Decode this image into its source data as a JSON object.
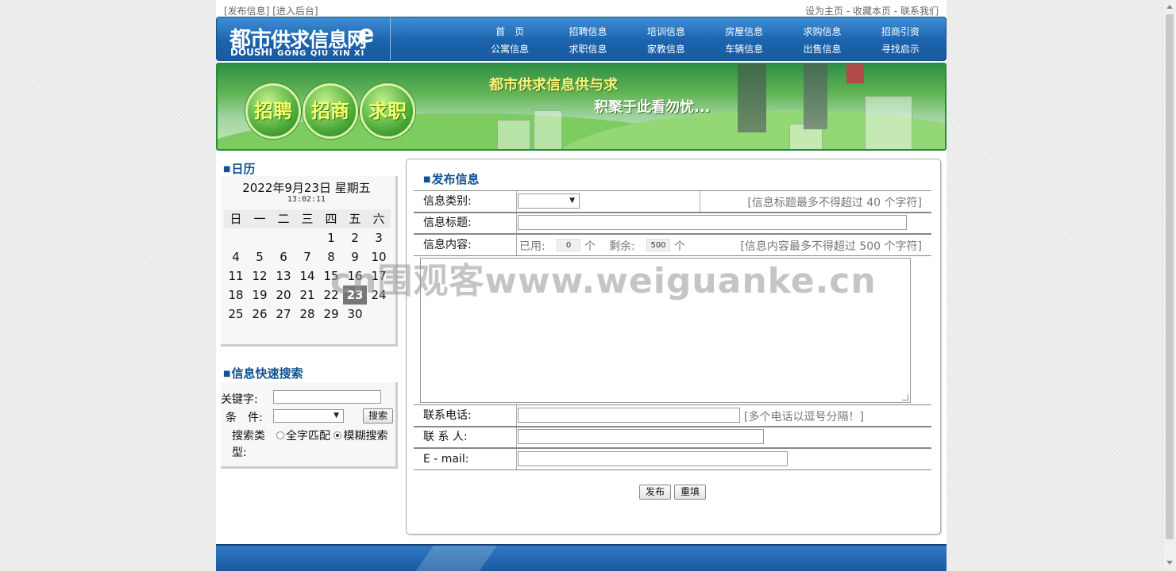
{
  "top_links": {
    "publish": "[发布信息]",
    "admin": "[进入后台]",
    "set_home": "设为主页",
    "sep1": " - ",
    "bookmark": "收藏本页",
    "sep2": " - ",
    "contact": "联系我们"
  },
  "logo": {
    "main_big": "都市",
    "main_rest": "供求信息网",
    "letter": "e",
    "sub_w1": "DOUSHI",
    "sub_w2": "GONG QIU XIN XI"
  },
  "nav": {
    "items": [
      "首　页",
      "招聘信息",
      "培训信息",
      "房屋信息",
      "求购信息",
      "招商引资",
      "公寓信息",
      "求职信息",
      "家教信息",
      "车辆信息",
      "出售信息",
      "寻找启示"
    ]
  },
  "banner": {
    "bubbles": [
      "招聘",
      "招商",
      "求职"
    ],
    "slogan1": "都市供求信息供与求",
    "slogan2": "积聚于此看勿忧..."
  },
  "calendar": {
    "title": "日历",
    "date": "2022年9月23日 星期五",
    "time": "13:02:11",
    "weekdays": [
      "日",
      "一",
      "二",
      "三",
      "四",
      "五",
      "六"
    ],
    "days": [
      "",
      "",
      "",
      "",
      "1",
      "2",
      "3",
      "4",
      "5",
      "6",
      "7",
      "8",
      "9",
      "10",
      "11",
      "12",
      "13",
      "14",
      "15",
      "16",
      "17",
      "18",
      "19",
      "20",
      "21",
      "22",
      "23",
      "24",
      "25",
      "26",
      "27",
      "28",
      "29",
      "30",
      ""
    ],
    "today": "23"
  },
  "search": {
    "title": "信息快速搜索",
    "keyword_label": "关键字:",
    "keyword_value": "",
    "condition_label": "条　件:",
    "condition_value": "",
    "button": "搜索",
    "type_label": "搜索类型:",
    "option_exact": "全字匹配",
    "option_fuzzy": "模糊搜索",
    "selected": "模糊搜索"
  },
  "form": {
    "title": "发布信息",
    "category_label": "信息类别:",
    "category_value": "",
    "category_hint": "[信息标题最多不得超过 40 个字符]",
    "title_label": "信息标题:",
    "title_value": "",
    "content_label": "信息内容:",
    "used_label": "已用:",
    "used_value": "0",
    "unit1": "个",
    "remaining_label": "剩余:",
    "remaining_value": "500",
    "unit2": "个",
    "content_hint": "[信息内容最多不得超过 500 个字符]",
    "content_value": "",
    "phone_label": "联系电话:",
    "phone_value": "",
    "phone_hint": "[多个电话以逗号分隔！]",
    "contact_label": "联 系 人:",
    "contact_value": "",
    "email_label": "E - mail:",
    "email_value": "",
    "submit": "发布",
    "reset": "重填"
  },
  "watermark": "cn围观客www.weiguanke.cn",
  "colors": {
    "header_blue": "#1c63ad",
    "title_blue": "#12528e",
    "banner_green": "#63b557"
  }
}
